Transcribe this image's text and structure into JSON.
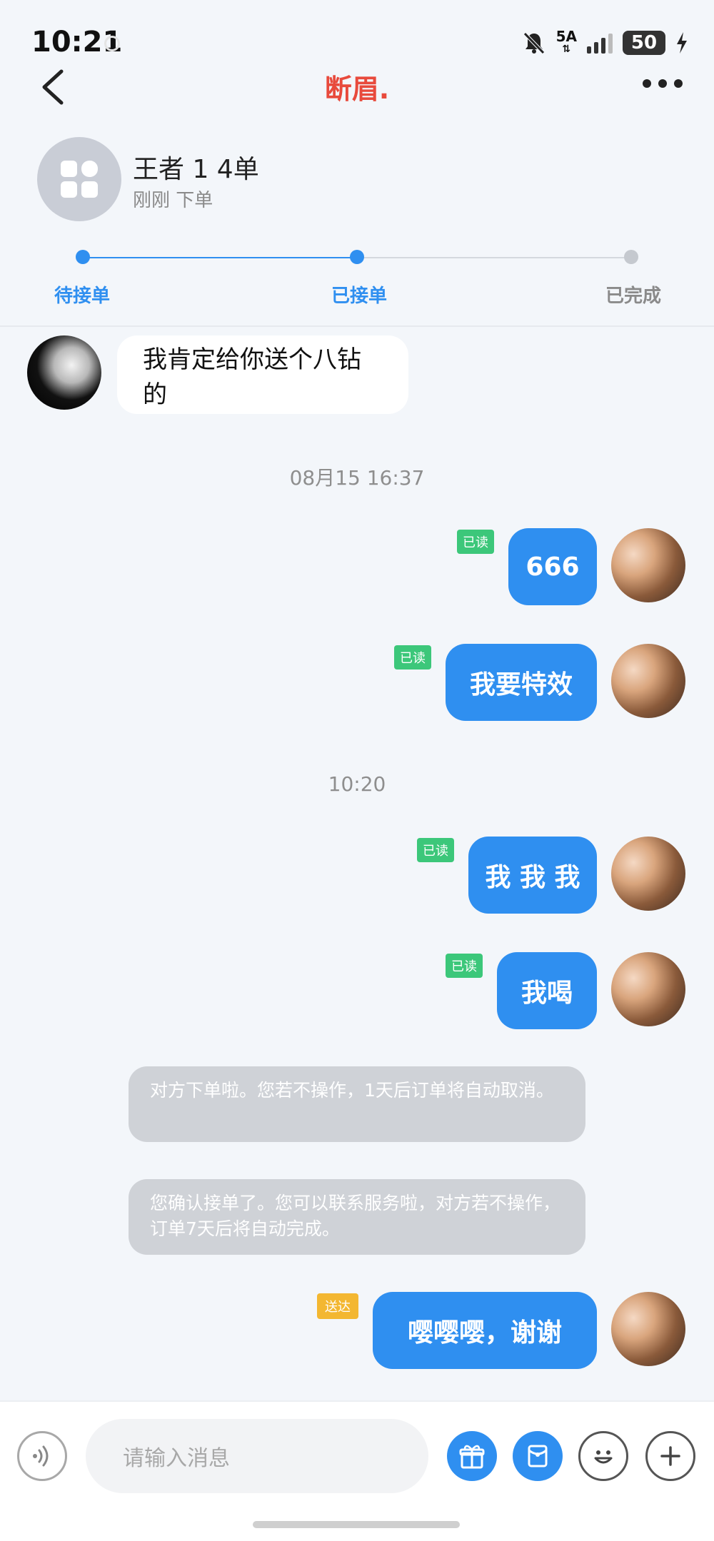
{
  "status_bar": {
    "time": "10:21",
    "network": "5A",
    "battery": "50"
  },
  "header": {
    "title": "断眉.",
    "back_icon": "chevron-left-icon",
    "more_icon": "more-dots-icon",
    "title_color": "#e84a3c"
  },
  "order": {
    "name": "王者 1 4单",
    "subtitle": "刚刚 下单",
    "steps": [
      {
        "label": "待接单",
        "state": "done"
      },
      {
        "label": "已接单",
        "state": "current"
      },
      {
        "label": "已完成",
        "state": "pending"
      }
    ],
    "accent_color": "#2f8ff0"
  },
  "messages": {
    "incoming_1": "我肯定给你送个八钻的",
    "timestamp_1": "08月15 16:37",
    "out_1": "666",
    "out_2": "我要特效",
    "timestamp_2": "10:20",
    "out_3": "我 我 我",
    "out_4": "我喝",
    "system_1": "对方下单啦。您若不操作，1天后订单将自动取消。",
    "system_2": "您确认接单了。您可以联系服务啦，对方若不操作，订单7天后将自动完成。",
    "out_5": "嘤嘤嘤，谢谢",
    "read_label": "已读",
    "delivered_label": "送达"
  },
  "input_bar": {
    "placeholder": "请输入消息",
    "voice_icon": "voice-icon",
    "gift_icon": "gift-icon",
    "red_packet_icon": "red-packet-icon",
    "emoji_icon": "emoji-icon",
    "plus_icon": "plus-icon"
  }
}
